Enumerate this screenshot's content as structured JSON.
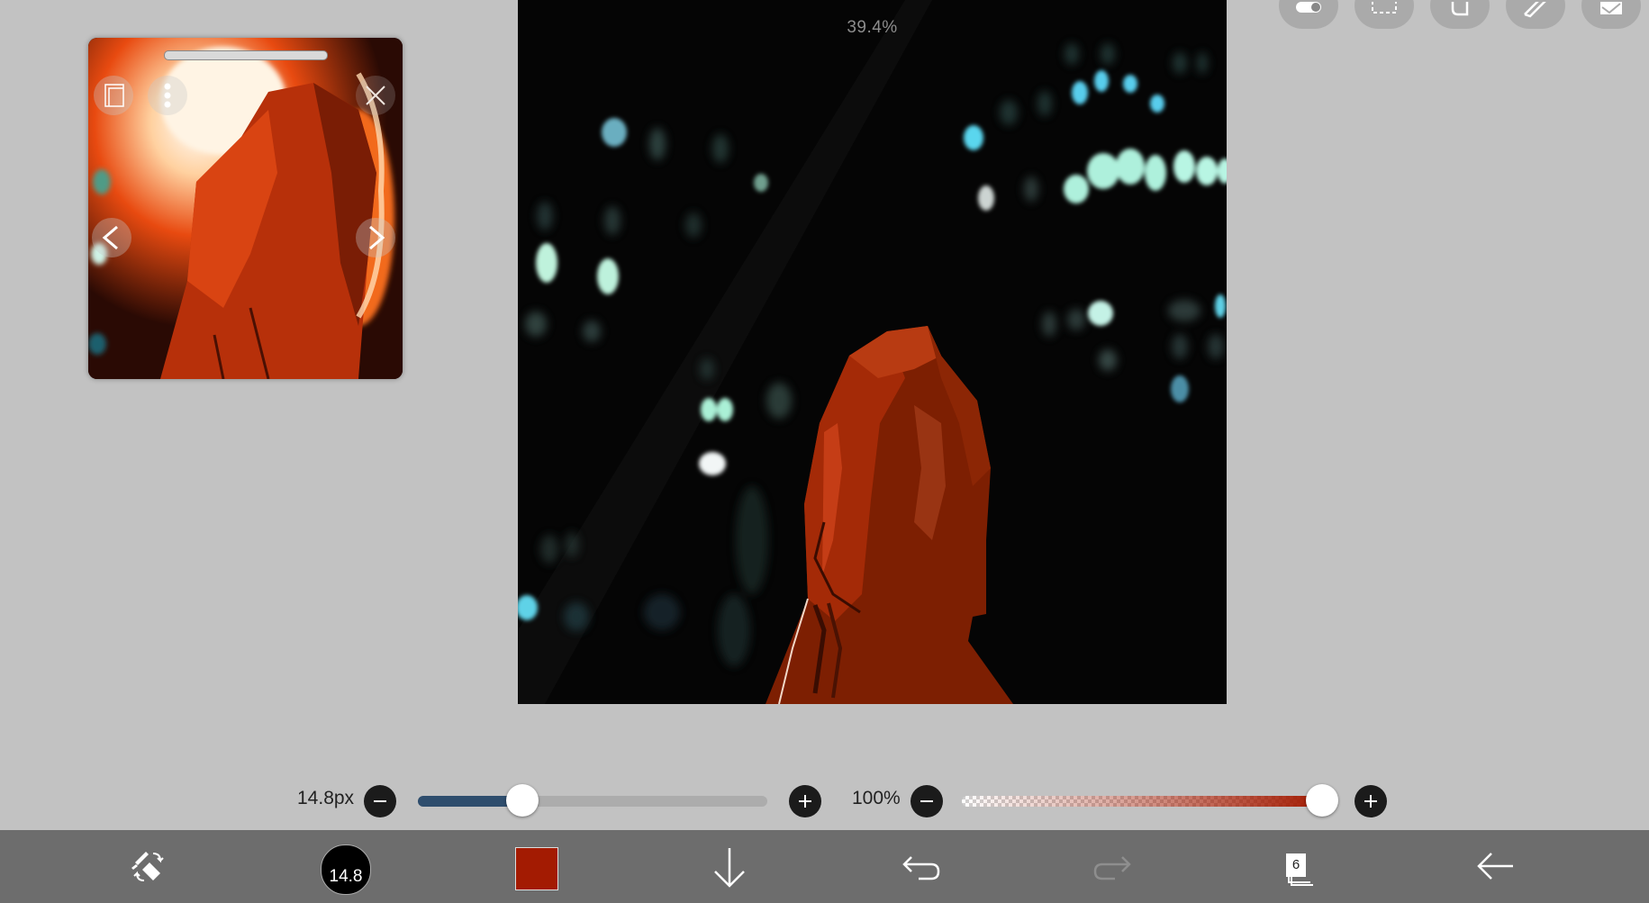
{
  "canvas": {
    "zoom": "39.4%"
  },
  "top_toolbar": {
    "tools": [
      {
        "name": "toggle-icon"
      },
      {
        "name": "selection-icon"
      },
      {
        "name": "lasso-icon"
      },
      {
        "name": "ruler-icon"
      },
      {
        "name": "material-icon"
      }
    ]
  },
  "reference_window": {
    "buttons": [
      "import-icon",
      "more-icon",
      "close-icon",
      "previous-icon",
      "next-icon"
    ]
  },
  "brush_size": {
    "label": "14.8px",
    "value_fraction": 0.3
  },
  "opacity": {
    "label": "100%",
    "value_fraction": 1.0
  },
  "bottom_bar": {
    "tools": [
      "brush-eraser-swap-icon",
      "brush-preview",
      "color-swatch",
      "down-arrow-icon",
      "undo-icon",
      "redo-icon",
      "layers-icon",
      "back-arrow-icon"
    ],
    "brush_preview_label": "14.8",
    "layer_count": "6",
    "accent_color": "#a31b02"
  }
}
